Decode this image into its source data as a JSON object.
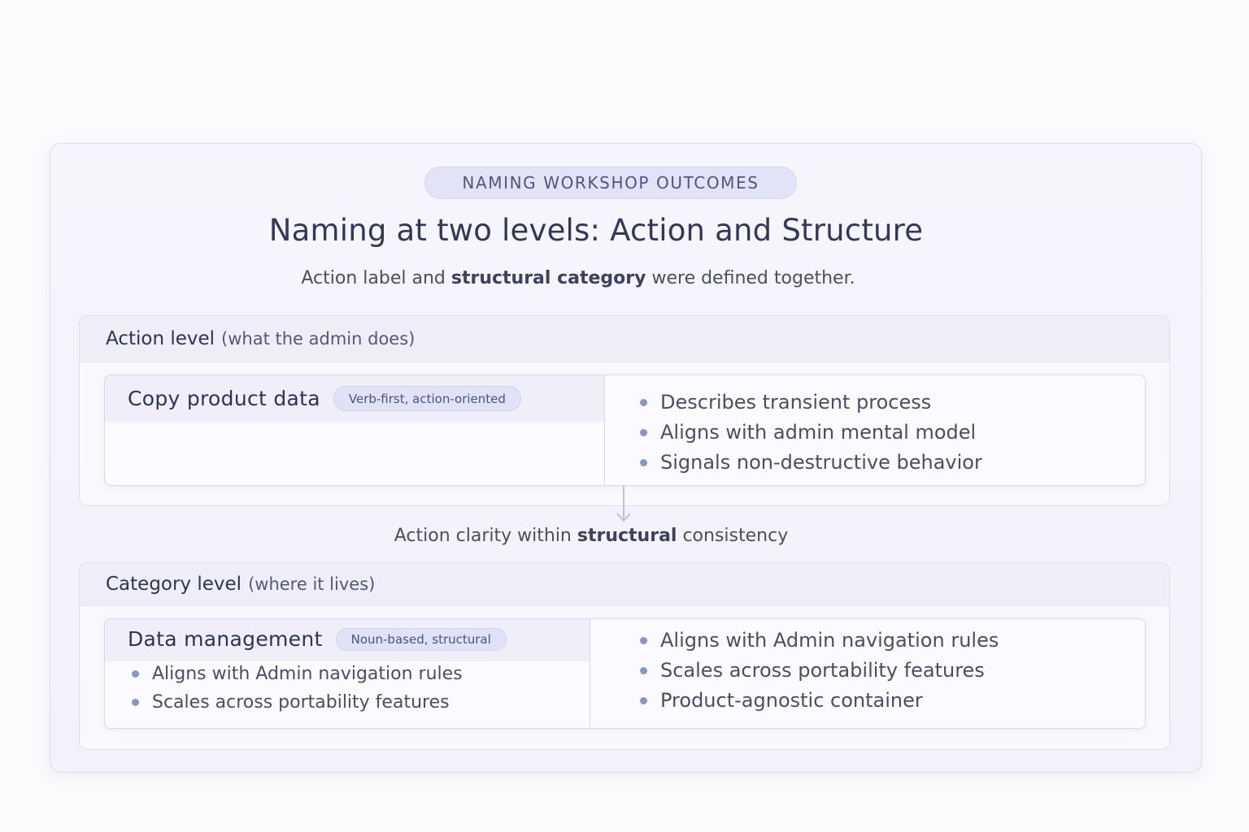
{
  "header": {
    "badge": "NAMING WORKSHOP OUTCOMES",
    "title": "Naming at two levels: Action and Structure",
    "subtitle_pre": "Action label and ",
    "subtitle_bold": "structural category",
    "subtitle_post": " were defined together."
  },
  "action_level": {
    "name": "Action level",
    "paren": "(what the admin does)",
    "term": "Copy product data",
    "pill": "Verb-first, action-oriented",
    "bullets": [
      "Describes transient process",
      "Aligns with admin mental model",
      "Signals non-destructive behavior"
    ]
  },
  "connector": {
    "pre": "Action clarity within ",
    "bold": "structural",
    "post": " consistency"
  },
  "category_level": {
    "name": "Category level",
    "paren": "(where it lives)",
    "term": "Data management",
    "pill": "Noun-based, structural",
    "left_bullets": [
      "Aligns with Admin navigation rules",
      "Scales across portability features"
    ],
    "bullets": [
      "Aligns with Admin navigation rules",
      "Scales across portability features",
      "Product-agnostic container"
    ]
  }
}
